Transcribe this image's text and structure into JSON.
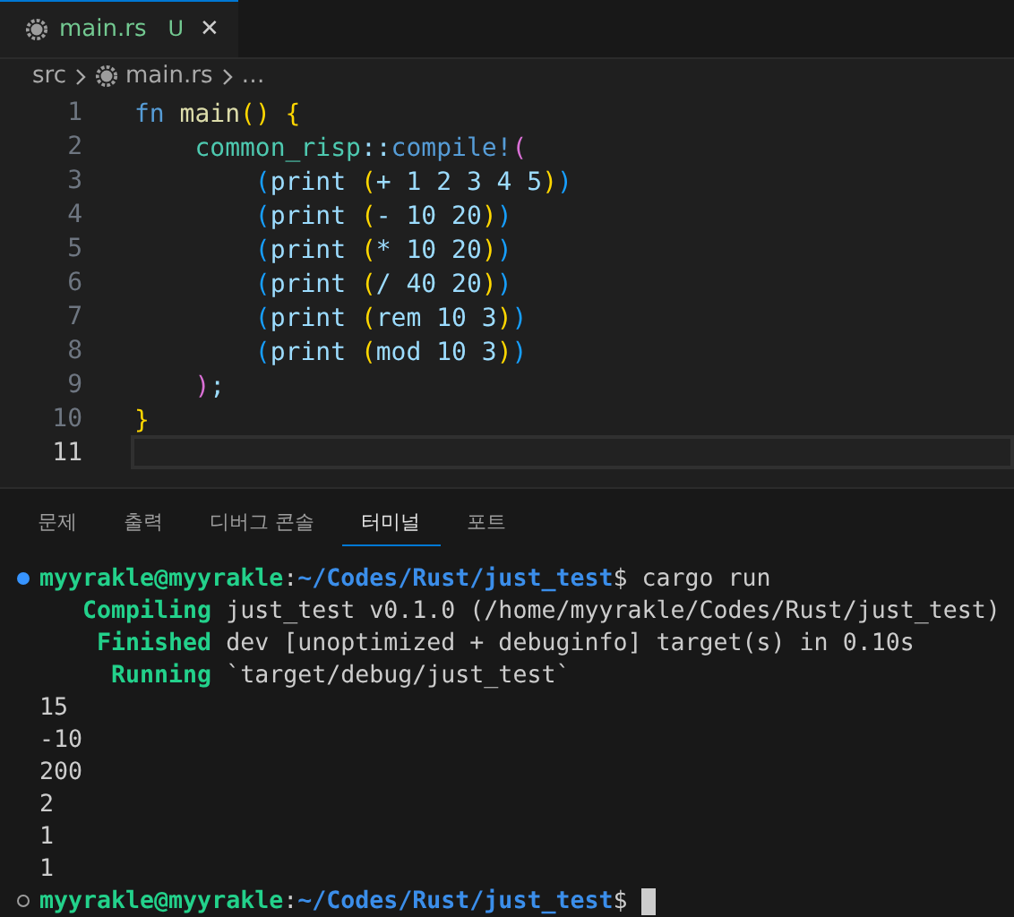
{
  "tabs": [
    {
      "label": "main.rs",
      "badge": "U",
      "close": "✕",
      "selected": true
    }
  ],
  "breadcrumb": [
    "src",
    "main.rs",
    "…"
  ],
  "editor": {
    "lines": [
      {
        "number": "1",
        "current": false,
        "tokens": [
          {
            "text": "fn ",
            "kind": "keyword"
          },
          {
            "text": "main",
            "kind": "function"
          },
          {
            "text": "() {",
            "kind": "bracket1"
          }
        ]
      },
      {
        "number": "2",
        "current": false,
        "tokens": [
          {
            "text": "    common_risp",
            "kind": "type"
          },
          {
            "text": "::",
            "kind": "plain"
          },
          {
            "text": "compile!",
            "kind": "macro"
          },
          {
            "text": "(",
            "kind": "bracket2"
          }
        ]
      },
      {
        "number": "3",
        "current": false,
        "tokens": [
          {
            "text": "        (",
            "kind": "bracket3"
          },
          {
            "text": "print ",
            "kind": "plain"
          },
          {
            "text": "(",
            "kind": "bracket1"
          },
          {
            "text": "+ 1 2 3 4 5",
            "kind": "plain"
          },
          {
            "text": ")",
            "kind": "bracket1"
          },
          {
            "text": ")",
            "kind": "bracket3"
          }
        ]
      },
      {
        "number": "4",
        "current": false,
        "tokens": [
          {
            "text": "        (",
            "kind": "bracket3"
          },
          {
            "text": "print ",
            "kind": "plain"
          },
          {
            "text": "(",
            "kind": "bracket1"
          },
          {
            "text": "- 10 20",
            "kind": "plain"
          },
          {
            "text": ")",
            "kind": "bracket1"
          },
          {
            "text": ")",
            "kind": "bracket3"
          }
        ]
      },
      {
        "number": "5",
        "current": false,
        "tokens": [
          {
            "text": "        (",
            "kind": "bracket3"
          },
          {
            "text": "print ",
            "kind": "plain"
          },
          {
            "text": "(",
            "kind": "bracket1"
          },
          {
            "text": "* 10 20",
            "kind": "plain"
          },
          {
            "text": ")",
            "kind": "bracket1"
          },
          {
            "text": ")",
            "kind": "bracket3"
          }
        ]
      },
      {
        "number": "6",
        "current": false,
        "tokens": [
          {
            "text": "        (",
            "kind": "bracket3"
          },
          {
            "text": "print ",
            "kind": "plain"
          },
          {
            "text": "(",
            "kind": "bracket1"
          },
          {
            "text": "/ 40 20",
            "kind": "plain"
          },
          {
            "text": ")",
            "kind": "bracket1"
          },
          {
            "text": ")",
            "kind": "bracket3"
          }
        ]
      },
      {
        "number": "7",
        "current": false,
        "tokens": [
          {
            "text": "        (",
            "kind": "bracket3"
          },
          {
            "text": "print ",
            "kind": "plain"
          },
          {
            "text": "(",
            "kind": "bracket1"
          },
          {
            "text": "rem 10 3",
            "kind": "plain"
          },
          {
            "text": ")",
            "kind": "bracket1"
          },
          {
            "text": ")",
            "kind": "bracket3"
          }
        ]
      },
      {
        "number": "8",
        "current": false,
        "tokens": [
          {
            "text": "        (",
            "kind": "bracket3"
          },
          {
            "text": "print ",
            "kind": "plain"
          },
          {
            "text": "(",
            "kind": "bracket1"
          },
          {
            "text": "mod 10 3",
            "kind": "plain"
          },
          {
            "text": ")",
            "kind": "bracket1"
          },
          {
            "text": ")",
            "kind": "bracket3"
          }
        ]
      },
      {
        "number": "9",
        "current": false,
        "tokens": [
          {
            "text": "    )",
            "kind": "bracket2"
          },
          {
            "text": ";",
            "kind": "plain"
          }
        ]
      },
      {
        "number": "10",
        "current": false,
        "tokens": [
          {
            "text": "}",
            "kind": "bracket1"
          }
        ]
      },
      {
        "number": "11",
        "current": true
      }
    ]
  },
  "panel_tabs": [
    {
      "label": "문제",
      "selected": false
    },
    {
      "label": "출력",
      "selected": false
    },
    {
      "label": "디버그 콘솔",
      "selected": false
    },
    {
      "label": "터미널",
      "selected": true
    },
    {
      "label": "포트",
      "selected": false
    }
  ],
  "terminal": [
    {
      "kind": "prompt_done",
      "segments": [
        {
          "text": "myyrakle@myyrakle",
          "kind": "user"
        },
        {
          "text": ":",
          "kind": "plain"
        },
        {
          "text": "~/Codes/Rust/just_test",
          "kind": "path"
        },
        {
          "text": "$ cargo run",
          "kind": "plain"
        }
      ]
    },
    {
      "kind": "output",
      "segments": [
        {
          "text": "   Compiling",
          "kind": "status"
        },
        {
          "text": " just_test v0.1.0 (/home/myyrakle/Codes/Rust/just_test)",
          "kind": "plain"
        }
      ]
    },
    {
      "kind": "output",
      "segments": [
        {
          "text": "    Finished",
          "kind": "status"
        },
        {
          "text": " dev [unoptimized + debuginfo] target(s) in 0.10s",
          "kind": "plain"
        }
      ]
    },
    {
      "kind": "output",
      "segments": [
        {
          "text": "     Running",
          "kind": "status"
        },
        {
          "text": " `target/debug/just_test`",
          "kind": "plain"
        }
      ]
    },
    {
      "kind": "output",
      "segments": [
        {
          "text": "15",
          "kind": "plain"
        }
      ]
    },
    {
      "kind": "output",
      "segments": [
        {
          "text": "-10",
          "kind": "plain"
        }
      ]
    },
    {
      "kind": "output",
      "segments": [
        {
          "text": "200",
          "kind": "plain"
        }
      ]
    },
    {
      "kind": "output",
      "segments": [
        {
          "text": "2",
          "kind": "plain"
        }
      ]
    },
    {
      "kind": "output",
      "segments": [
        {
          "text": "1",
          "kind": "plain"
        }
      ]
    },
    {
      "kind": "output",
      "segments": [
        {
          "text": "1",
          "kind": "plain"
        }
      ]
    },
    {
      "kind": "prompt_active",
      "cursor": true,
      "segments": [
        {
          "text": "myyrakle@myyrakle",
          "kind": "user"
        },
        {
          "text": ":",
          "kind": "plain"
        },
        {
          "text": "~/Codes/Rust/just_test",
          "kind": "path"
        },
        {
          "text": "$",
          "kind": "plain"
        }
      ]
    }
  ]
}
